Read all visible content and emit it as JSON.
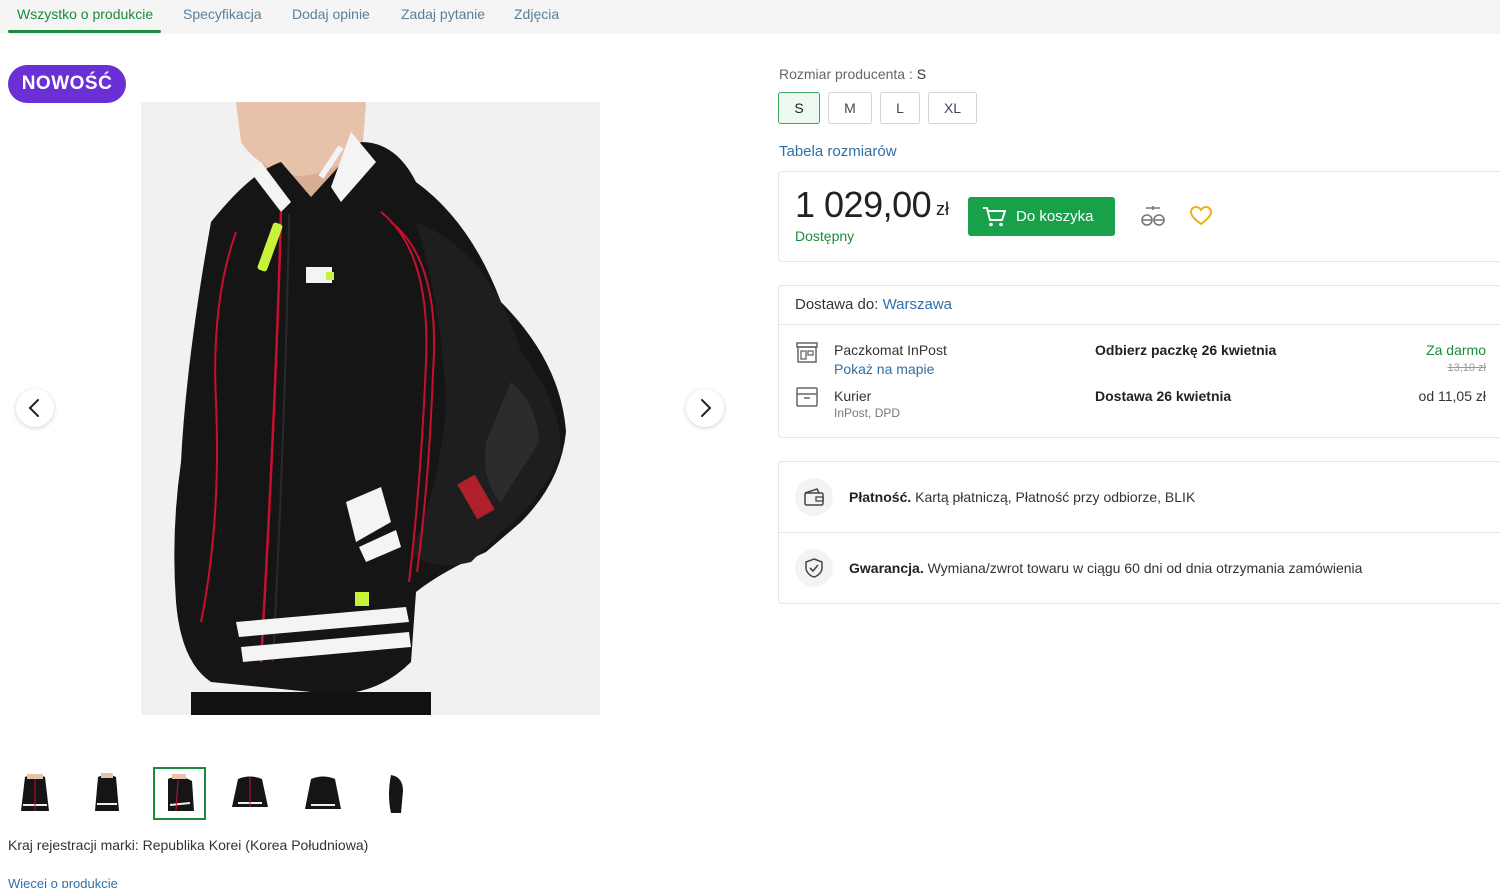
{
  "tabs": [
    {
      "label": "Wszystko o produkcie",
      "active": true
    },
    {
      "label": "Specyfikacja",
      "active": false
    },
    {
      "label": "Dodaj opinie",
      "active": false
    },
    {
      "label": "Zadaj pytanie",
      "active": false
    },
    {
      "label": "Zdjęcia",
      "active": false
    }
  ],
  "badge": "NOWOŚĆ",
  "gallery": {
    "thumbnail_count": 6,
    "selected_thumbnail": 3
  },
  "brand_country": "Kraj rejestracji marki: Republika Korei (Korea Południowa)",
  "more_link": "Więcej o produkcie",
  "size": {
    "label": "Rozmiar producenta :",
    "selected": "S",
    "options": [
      "S",
      "M",
      "L",
      "XL"
    ],
    "table_link": "Tabela rozmiarów"
  },
  "price": {
    "amount": "1 029,00",
    "currency": "zł",
    "availability": "Dostępny",
    "cart_button": "Do koszyka"
  },
  "delivery": {
    "heading": "Dostawa do:",
    "city": "Warszawa",
    "options": [
      {
        "name": "Paczkomat InPost",
        "link": "Pokaż na mapie",
        "date": "Odbierz paczkę 26 kwietnia",
        "price": "Za darmo",
        "old_price": "13,10 zł"
      },
      {
        "name": "Kurier",
        "sub": "InPost, DPD",
        "date": "Dostawa 26 kwietnia",
        "price": "od 11,05 zł"
      }
    ]
  },
  "info": {
    "payment_label": "Płatność.",
    "payment_text": "Kartą płatniczą, Płatność przy odbiorze, BLIK",
    "warranty_label": "Gwarancja.",
    "warranty_text": "Wymiana/zwrot towaru w ciągu 60 dni od dnia otrzymania zamówienia"
  },
  "colors": {
    "accent_green": "#1b8a3c",
    "button_green": "#19a04b",
    "link_blue": "#2f6fa8",
    "badge_purple": "#6b2fd6",
    "heart_yellow": "#e8b21a"
  },
  "icons": [
    "chevron-left-icon",
    "chevron-right-icon",
    "cart-icon",
    "compare-icon",
    "heart-icon",
    "parcel-locker-icon",
    "courier-box-icon",
    "wallet-icon",
    "shield-check-icon"
  ]
}
